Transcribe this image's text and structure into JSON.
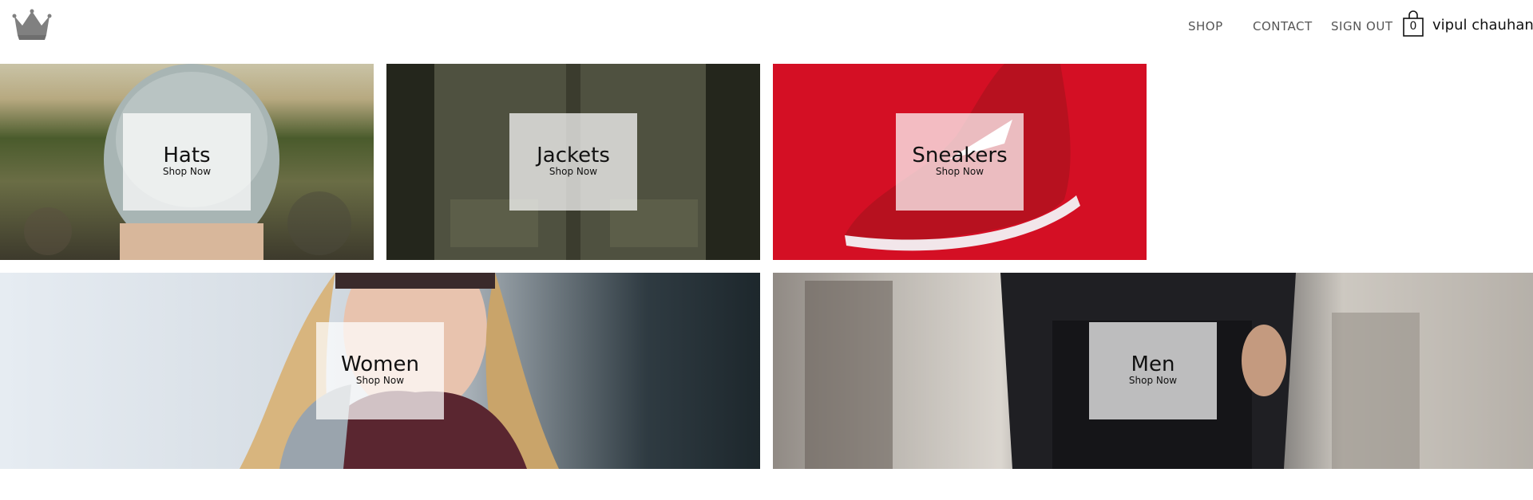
{
  "header": {
    "logo_icon": "crown-icon",
    "nav": {
      "shop": "SHOP",
      "contact": "CONTACT",
      "sign_out": "SIGN OUT"
    },
    "cart": {
      "icon": "shopping-bag-icon",
      "count": "0"
    },
    "user_name": "vipul chauhan"
  },
  "categories": [
    {
      "title": "Hats",
      "subtitle": "Shop Now"
    },
    {
      "title": "Jackets",
      "subtitle": "Shop Now"
    },
    {
      "title": "Sneakers",
      "subtitle": "Shop Now"
    },
    {
      "title": "Women",
      "subtitle": "Shop Now"
    },
    {
      "title": "Men",
      "subtitle": "Shop Now"
    }
  ],
  "colors": {
    "nav_text": "#555555",
    "sneakers_background": "#d40f24",
    "overlay_box": "#ffffff"
  }
}
